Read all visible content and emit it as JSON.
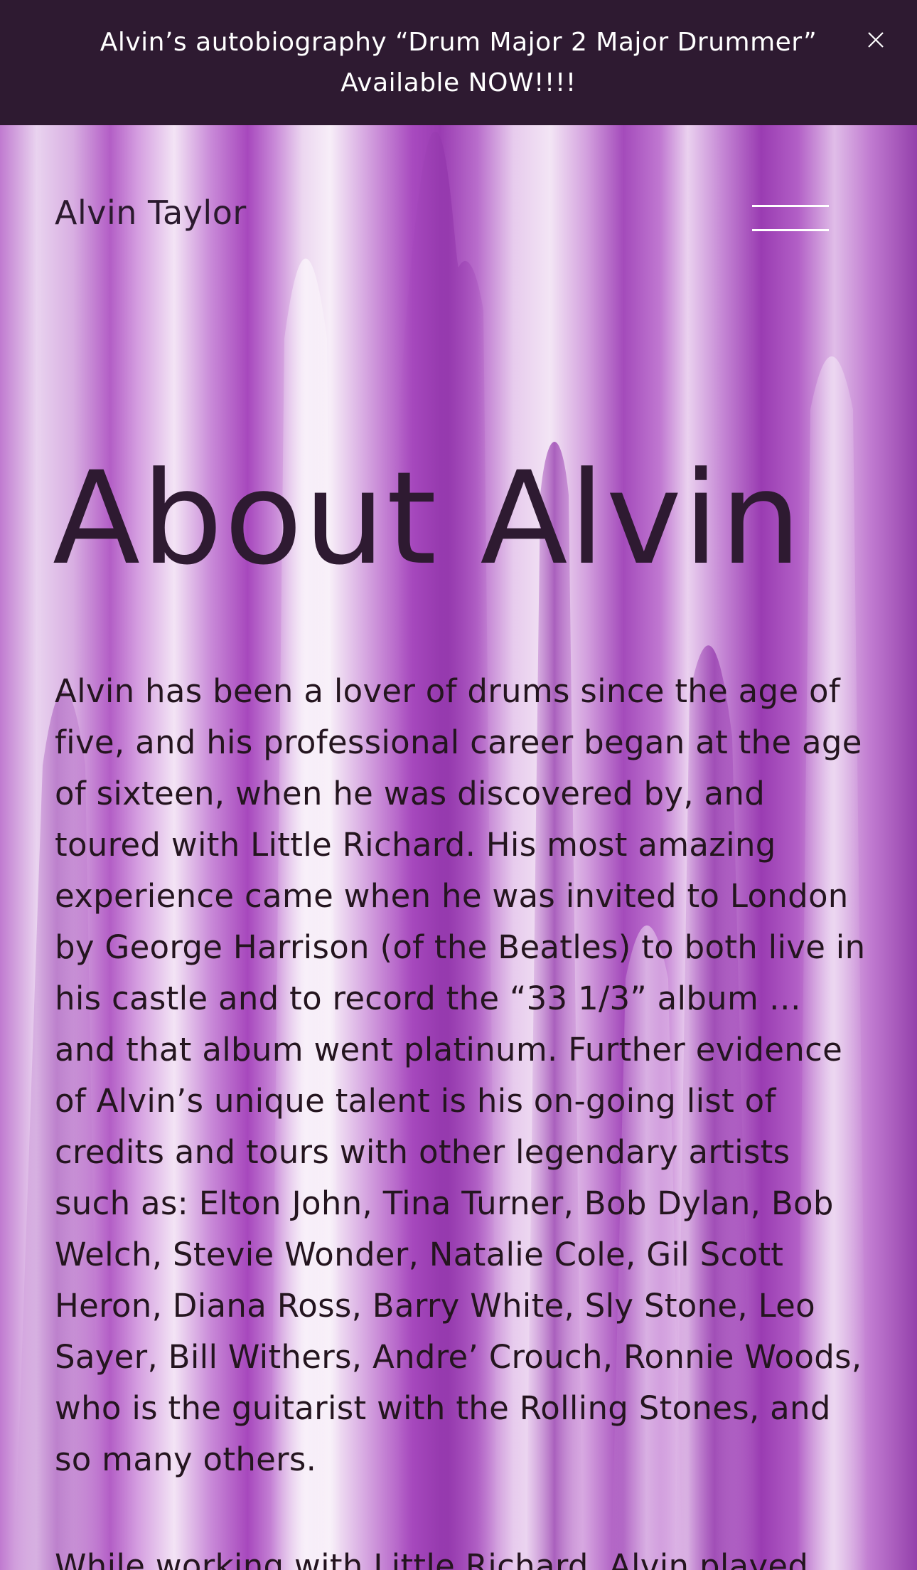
{
  "banner": {
    "text": "Alvin’s autobiography “Drum Major 2 Major Drummer” Available NOW!!!!",
    "close_icon": "close-icon"
  },
  "header": {
    "site_title": "Alvin Taylor",
    "menu_icon": "hamburger-menu-icon"
  },
  "main": {
    "title": "About Alvin",
    "paragraphs": [
      "Alvin has been a lover of drums since the age of five, and his professional career began at the age of sixteen, when he was discovered by, and toured with Little Richard. His most amazing experience came when he was invited to London by George Harrison (of the Beatles) to both live in his castle and to record the “33 1/3” album … and that album went platinum. Further evidence of Alvin’s unique talent is his on-going list of credits and tours with other legendary artists such as: Elton John, Tina Turner, Bob Dylan, Bob Welch, Stevie Wonder, Natalie Cole, Gil Scott Heron, Diana Ross, Barry White, Sly Stone, Leo Sayer, Bill Withers, Andre’ Crouch, Ronnie Woods, who is the guitarist with the Rolling Stones, and so many others.",
      "While working with Little Richard, Alvin played"
    ]
  },
  "colors": {
    "banner_bg": "#2e1a31",
    "banner_text": "#ffffff",
    "heading": "#2e1a31",
    "body_text": "#24151f",
    "accent_purple": "#9a3fb0"
  }
}
